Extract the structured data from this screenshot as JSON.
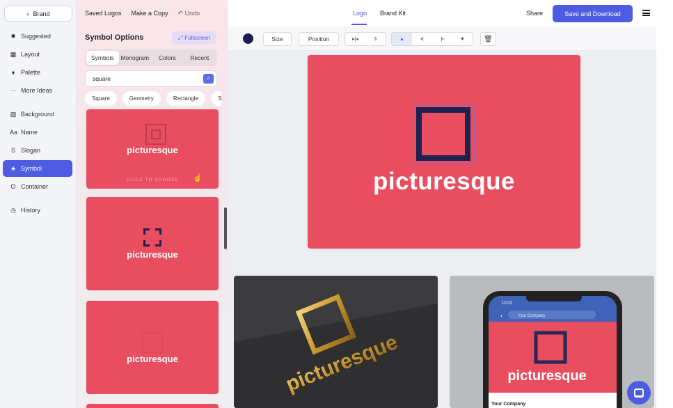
{
  "sidebar": {
    "brand_label": "Brand",
    "items": [
      {
        "icon": "sparkle-icon",
        "glyph": "✹",
        "label": "Suggested"
      },
      {
        "icon": "layout-icon",
        "glyph": "▦",
        "label": "Layout"
      },
      {
        "icon": "palette-icon",
        "glyph": "♦",
        "label": "Palette"
      },
      {
        "icon": "more-icon",
        "glyph": "···",
        "label": "More Ideas"
      },
      {
        "icon": "background-icon",
        "glyph": "▨",
        "label": "Background"
      },
      {
        "icon": "name-icon",
        "glyph": "Aa",
        "label": "Name"
      },
      {
        "icon": "slogan-icon",
        "glyph": "S",
        "label": "Slogan"
      },
      {
        "icon": "star-icon",
        "glyph": "★",
        "label": "Symbol",
        "active": true
      },
      {
        "icon": "container-icon",
        "glyph": "O",
        "label": "Container"
      },
      {
        "icon": "history-icon",
        "glyph": "◷",
        "label": "History"
      }
    ]
  },
  "panel": {
    "saved_logos": "Saved Logos",
    "make_copy": "Make a Copy",
    "undo": "Undo",
    "title": "Symbol Options",
    "fullscreen": "Fullscreen",
    "tabs": [
      "Symbols",
      "Monogram",
      "Colors",
      "Recent"
    ],
    "search_value": "square",
    "chips": [
      "Square",
      "Geometry",
      "Rectangle",
      "S"
    ],
    "cards": [
      {
        "word": "picturesque",
        "hint": "CLICK TO CHOOSE"
      },
      {
        "word": "picturesque"
      },
      {
        "word": "picturesque"
      }
    ]
  },
  "topbar": {
    "tab_logo": "Logo",
    "tab_brand_kit": "Brand Kit",
    "share": "Share",
    "save_download": "Save and Download"
  },
  "toolbar": {
    "color": "#1f1f4f",
    "size": "Size",
    "position": "Position"
  },
  "preview": {
    "brand_name": "picturesque",
    "background": "#e84e5f",
    "symbol_color": "#1f2150",
    "phone": {
      "time": "10:03",
      "search_placeholder": "Your Company",
      "footer_title": "Your Company"
    }
  },
  "colors": {
    "accent": "#4d5ce0"
  }
}
